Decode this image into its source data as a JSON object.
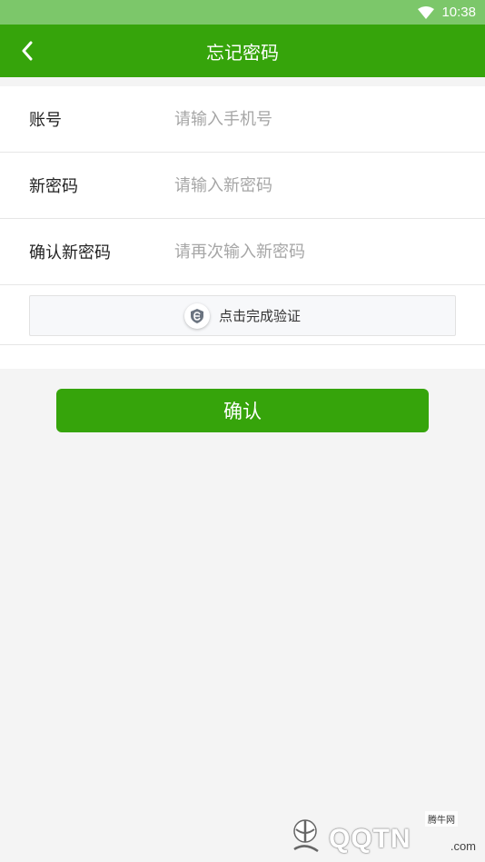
{
  "status_bar": {
    "time": "10:38"
  },
  "header": {
    "title": "忘记密码"
  },
  "form": {
    "account": {
      "label": "账号",
      "placeholder": "请输入手机号",
      "value": ""
    },
    "new_password": {
      "label": "新密码",
      "placeholder": "请输入新密码",
      "value": ""
    },
    "confirm_password": {
      "label": "确认新密码",
      "placeholder": "请再次输入新密码",
      "value": ""
    },
    "verify": {
      "label": "点击完成验证"
    }
  },
  "confirm_button": {
    "label": "确认"
  },
  "watermark": {
    "site": "腾牛网",
    "brand": "QQTN",
    "domain": ".com"
  },
  "colors": {
    "primary": "#36a40b",
    "status_bar": "#7cc76a",
    "background": "#f4f4f4"
  }
}
